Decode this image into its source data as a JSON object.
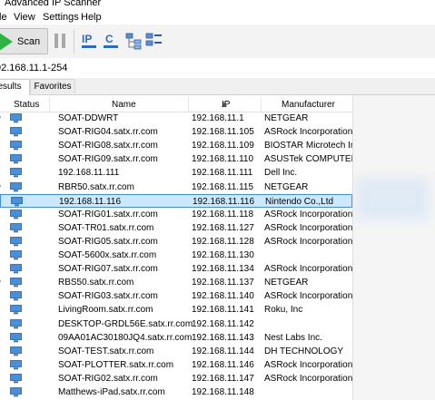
{
  "window": {
    "title": "Advanced IP Scanner"
  },
  "menu": {
    "file": "le",
    "view": "View",
    "settings": "Settings",
    "help": "Help"
  },
  "toolbar": {
    "scan_label": "Scan"
  },
  "range_input": {
    "value": "92.168.11.1-254"
  },
  "tabs": {
    "results": "esults",
    "favorites": "Favorites"
  },
  "columns": {
    "status": "Status",
    "name": "Name",
    "ip": "IP",
    "manufacturer": "Manufacturer"
  },
  "icons": {
    "scan": "play-icon",
    "pause": "pause-icon",
    "ip": "ip-icon",
    "c_class": "c-subnet-icon",
    "expand": "expand-icon",
    "collapse": "collapse-icon",
    "device": "computer-icon"
  },
  "colors": {
    "selection_bg": "#cce8ff",
    "selection_border": "#3d8fd8",
    "scan_green": "#2fb244",
    "toolbar_blue": "#2b6cc4"
  },
  "rows": [
    {
      "expandable": true,
      "name": "SOAT-DDWRT",
      "ip": "192.168.11.1",
      "manufacturer": "NETGEAR"
    },
    {
      "expandable": false,
      "name": "SOAT-RIG04.satx.rr.com",
      "ip": "192.168.11.105",
      "manufacturer": "ASRock Incorporation"
    },
    {
      "expandable": false,
      "name": "SOAT-RIG08.satx.rr.com",
      "ip": "192.168.11.109",
      "manufacturer": "BIOSTAR Microtech In..."
    },
    {
      "expandable": false,
      "name": "SOAT-RIG09.satx.rr.com",
      "ip": "192.168.11.110",
      "manufacturer": "ASUSTek COMPUTER I..."
    },
    {
      "expandable": false,
      "name": "192.168.11.111",
      "ip": "192.168.11.111",
      "manufacturer": "Dell Inc."
    },
    {
      "expandable": true,
      "name": "RBR50.satx.rr.com",
      "ip": "192.168.11.115",
      "manufacturer": "NETGEAR"
    },
    {
      "expandable": false,
      "name": "192.168.11.116",
      "ip": "192.168.11.116",
      "manufacturer": "Nintendo Co.,Ltd",
      "selected": true
    },
    {
      "expandable": false,
      "name": "SOAT-RIG01.satx.rr.com",
      "ip": "192.168.11.118",
      "manufacturer": "ASRock Incorporation"
    },
    {
      "expandable": false,
      "name": "SOAT-TR01.satx.rr.com",
      "ip": "192.168.11.127",
      "manufacturer": "ASRock Incorporation"
    },
    {
      "expandable": false,
      "name": "SOAT-RIG05.satx.rr.com",
      "ip": "192.168.11.128",
      "manufacturer": "ASRock Incorporation"
    },
    {
      "expandable": false,
      "name": "SOAT-5600x.satx.rr.com",
      "ip": "192.168.11.130",
      "manufacturer": ""
    },
    {
      "expandable": false,
      "name": "SOAT-RIG07.satx.rr.com",
      "ip": "192.168.11.134",
      "manufacturer": "ASRock Incorporation"
    },
    {
      "expandable": true,
      "name": "RBS50.satx.rr.com",
      "ip": "192.168.11.137",
      "manufacturer": "NETGEAR"
    },
    {
      "expandable": false,
      "name": "SOAT-RIG03.satx.rr.com",
      "ip": "192.168.11.140",
      "manufacturer": "ASRock Incorporation"
    },
    {
      "expandable": false,
      "name": "LivingRoom.satx.rr.com",
      "ip": "192.168.11.141",
      "manufacturer": "Roku, Inc"
    },
    {
      "expandable": false,
      "name": "DESKTOP-GRDL56E.satx.rr.com",
      "ip": "192.168.11.142",
      "manufacturer": ""
    },
    {
      "expandable": false,
      "name": "09AA01AC30180JQ4.satx.rr.com",
      "ip": "192.168.11.143",
      "manufacturer": "Nest Labs Inc."
    },
    {
      "expandable": false,
      "name": "SOAT-TEST.satx.rr.com",
      "ip": "192.168.11.144",
      "manufacturer": "DH TECHNOLOGY"
    },
    {
      "expandable": false,
      "name": "SOAT-PLOTTER.satx.rr.com",
      "ip": "192.168.11.146",
      "manufacturer": "ASRock Incorporation"
    },
    {
      "expandable": false,
      "name": "SOAT-RIG02.satx.rr.com",
      "ip": "192.168.11.147",
      "manufacturer": "ASRock Incorporation"
    },
    {
      "expandable": false,
      "name": "Matthews-iPad.satx.rr.com",
      "ip": "192.168.11.148",
      "manufacturer": ""
    }
  ]
}
